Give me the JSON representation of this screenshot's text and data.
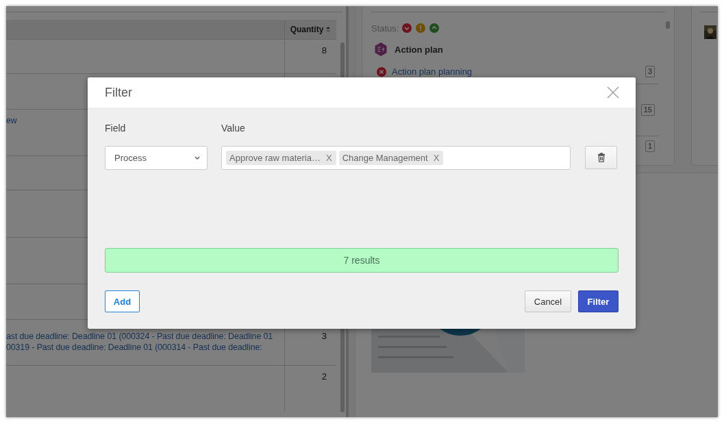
{
  "background": {
    "table": {
      "quantity_header": "Quantity",
      "sorted": true,
      "rows": [
        {
          "quantity": "8"
        },
        {},
        {
          "lines": [
            "ew"
          ]
        },
        {},
        {},
        {},
        {},
        {
          "lines": [
            "ast due deadline: Deadline 01 (000324 - Past due deadline: Deadline 01",
            "00319 - Past due deadline: Deadline 01 (000314 - Past due deadline:"
          ],
          "quantity": "3"
        },
        {
          "quantity": "2"
        }
      ]
    },
    "panel": {
      "status_label": "Status:",
      "status_icons": [
        {
          "kind": "down"
        },
        {
          "kind": "alert"
        },
        {
          "kind": "up"
        }
      ],
      "heading": "Action plan",
      "items": [
        {
          "label": "Action plan planning",
          "count": "3",
          "kind": "late"
        },
        {
          "count": "15"
        },
        {
          "count": "1"
        }
      ]
    }
  },
  "dialog": {
    "title": "Filter",
    "field_label": "Field",
    "value_label": "Value",
    "rows": [
      {
        "field": "Process",
        "tags": [
          {
            "text": "Approve raw materia…",
            "remove": "X"
          },
          {
            "text": "Change Management",
            "remove": "X"
          }
        ]
      }
    ],
    "results": "7 results",
    "add": "Add",
    "cancel": "Cancel",
    "filter": "Filter"
  }
}
